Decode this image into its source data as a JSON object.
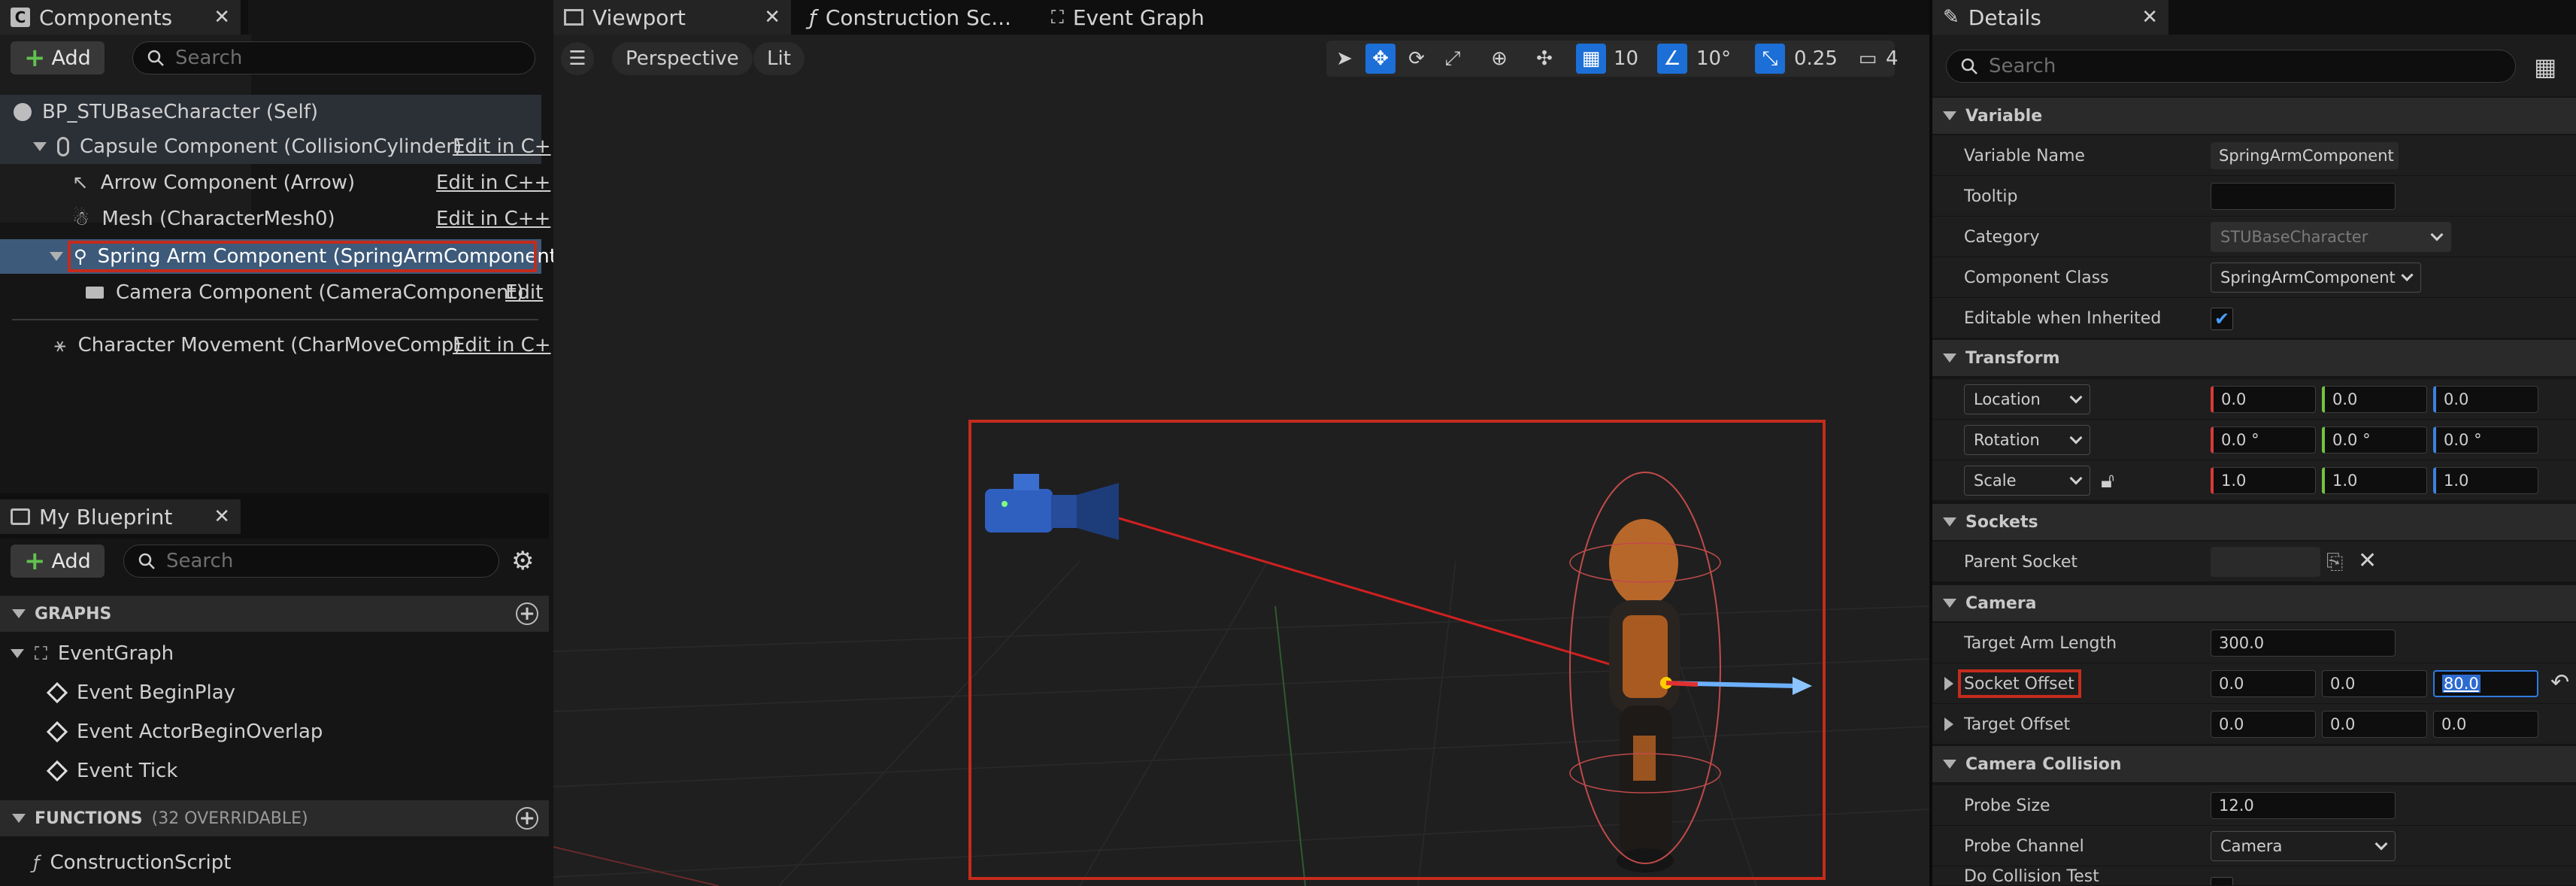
{
  "components_panel": {
    "tab_title": "Components",
    "add_label": "Add",
    "search_placeholder": "Search",
    "tree": [
      {
        "label": "BP_STUBaseCharacter (Self)",
        "edit": ""
      },
      {
        "label": "Capsule Component (CollisionCylinder)",
        "edit": "Edit in C+"
      },
      {
        "label": "Arrow Component (Arrow)",
        "edit": "Edit in C++"
      },
      {
        "label": "Mesh (CharacterMesh0)",
        "edit": "Edit in C++"
      },
      {
        "label": "Spring Arm Component (SpringArmComponent)",
        "edit": ""
      },
      {
        "label": "Camera Component (CameraComponent)",
        "edit": "Edit"
      },
      {
        "label": "Character Movement (CharMoveComp)",
        "edit": "Edit in C+"
      }
    ]
  },
  "blueprint_panel": {
    "tab_title": "My Blueprint",
    "add_label": "Add",
    "search_placeholder": "Search",
    "graphs_header": "GRAPHS",
    "event_graph": "EventGraph",
    "events": [
      "Event BeginPlay",
      "Event ActorBeginOverlap",
      "Event Tick"
    ],
    "functions_header": "FUNCTIONS",
    "functions_note": "(32 OVERRIDABLE)",
    "construction_script": "ConstructionScript"
  },
  "viewport": {
    "tabs": [
      "Viewport",
      "Construction Sc...",
      "Event Graph"
    ],
    "perspective_label": "Perspective",
    "lit_label": "Lit",
    "grid_snap": "10",
    "rotation_snap": "10°",
    "scale_snap": "0.25",
    "camera_speed": "4"
  },
  "details": {
    "tab_title": "Details",
    "search_placeholder": "Search",
    "sections": {
      "variable": "Variable",
      "transform": "Transform",
      "sockets": "Sockets",
      "camera": "Camera",
      "camera_collision": "Camera Collision"
    },
    "variable_name_label": "Variable Name",
    "variable_name_value": "SpringArmComponent",
    "tooltip_label": "Tooltip",
    "tooltip_value": "",
    "category_label": "Category",
    "category_value": "STUBaseCharacter",
    "component_class_label": "Component Class",
    "component_class_value": "SpringArmComponent",
    "editable_label": "Editable when Inherited",
    "location_label": "Location",
    "location": [
      "0.0",
      "0.0",
      "0.0"
    ],
    "rotation_label": "Rotation",
    "rotation": [
      "0.0 °",
      "0.0 °",
      "0.0 °"
    ],
    "scale_label": "Scale",
    "scale": [
      "1.0",
      "1.0",
      "1.0"
    ],
    "parent_socket_label": "Parent Socket",
    "target_arm_length_label": "Target Arm Length",
    "target_arm_length": "300.0",
    "socket_offset_label": "Socket Offset",
    "socket_offset": [
      "0.0",
      "0.0",
      "80.0"
    ],
    "target_offset_label": "Target Offset",
    "target_offset": [
      "0.0",
      "0.0",
      "0.0"
    ],
    "probe_size_label": "Probe Size",
    "probe_size": "12.0",
    "probe_channel_label": "Probe Channel",
    "probe_channel": "Camera",
    "do_collision_label": "Do Collision Test"
  },
  "colors": {
    "accent": "#1c6fd6",
    "highlight": "#c42b1c",
    "selected_row": "#3d5a7a"
  }
}
